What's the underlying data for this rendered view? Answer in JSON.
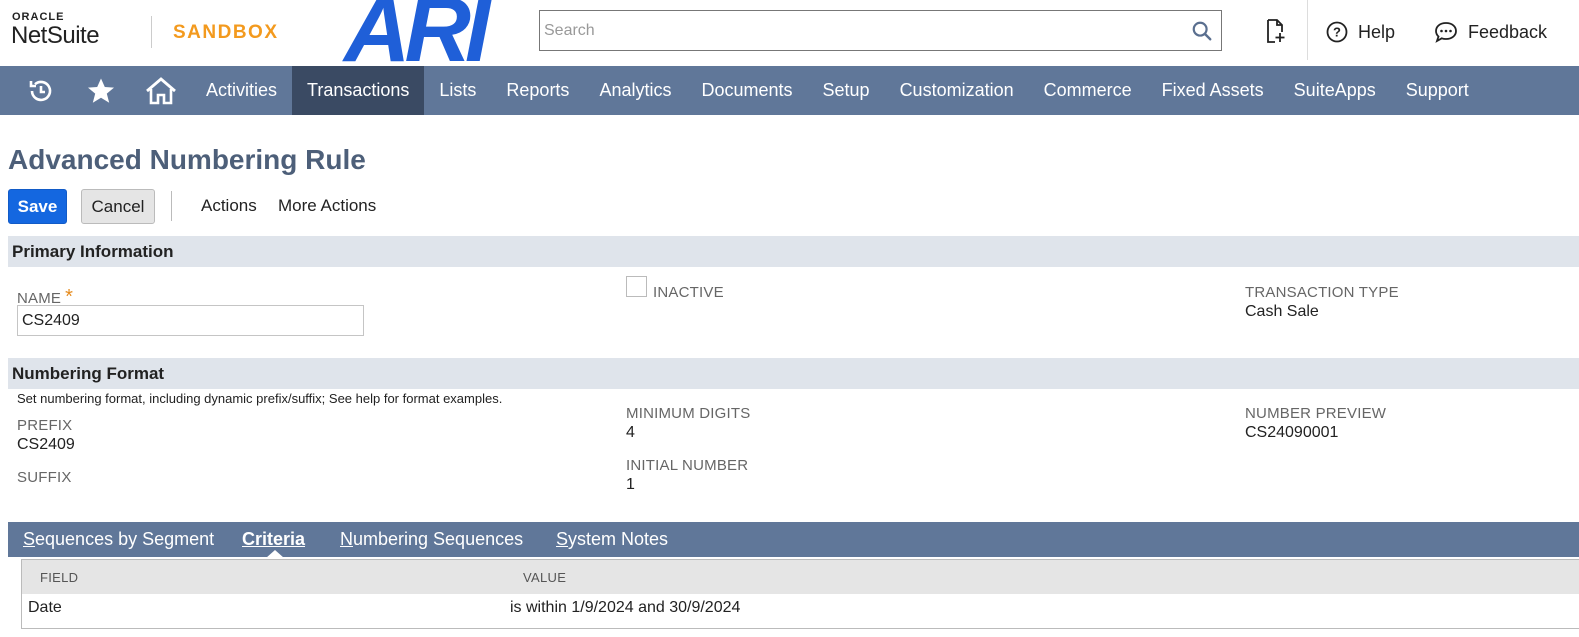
{
  "header": {
    "oracle_label": "ORACLE",
    "netsuite_label": "NetSuite",
    "sandbox_label": "SANDBOX",
    "brand_logo": "ARI",
    "search_placeholder": "Search",
    "help_label": "Help",
    "feedback_label": "Feedback",
    "icons": [
      "search-icon",
      "new-record-icon",
      "help-icon",
      "feedback-icon"
    ]
  },
  "nav": {
    "icons": [
      "recent-icon",
      "star-icon",
      "home-icon"
    ],
    "items": [
      {
        "label": "Activities",
        "active": false
      },
      {
        "label": "Transactions",
        "active": true
      },
      {
        "label": "Lists",
        "active": false
      },
      {
        "label": "Reports",
        "active": false
      },
      {
        "label": "Analytics",
        "active": false
      },
      {
        "label": "Documents",
        "active": false
      },
      {
        "label": "Setup",
        "active": false
      },
      {
        "label": "Customization",
        "active": false
      },
      {
        "label": "Commerce",
        "active": false
      },
      {
        "label": "Fixed Assets",
        "active": false
      },
      {
        "label": "SuiteApps",
        "active": false
      },
      {
        "label": "Support",
        "active": false
      }
    ]
  },
  "page": {
    "title": "Advanced Numbering Rule",
    "save_label": "Save",
    "cancel_label": "Cancel",
    "actions_label": "Actions",
    "more_actions_label": "More Actions"
  },
  "primary": {
    "section_title": "Primary Information",
    "name_label": "NAME",
    "name_value": "CS2409",
    "inactive_label": "INACTIVE",
    "inactive_checked": false,
    "transaction_type_label": "TRANSACTION TYPE",
    "transaction_type_value": "Cash Sale"
  },
  "numbering": {
    "section_title": "Numbering Format",
    "help_text": "Set numbering format, including dynamic prefix/suffix; See help for format examples.",
    "prefix_label": "PREFIX",
    "prefix_value": "CS2409",
    "suffix_label": "SUFFIX",
    "suffix_value": "",
    "min_digits_label": "MINIMUM DIGITS",
    "min_digits_value": "4",
    "initial_number_label": "INITIAL NUMBER",
    "initial_number_value": "1",
    "preview_label": "NUMBER PREVIEW",
    "preview_value": "CS24090001"
  },
  "subtabs": {
    "tabs": [
      {
        "first": "S",
        "rest": "equences by Segment",
        "active": false
      },
      {
        "first": "C",
        "rest": "riteria",
        "active": true
      },
      {
        "first": "N",
        "rest": "umbering Sequences",
        "active": false
      },
      {
        "first": "S",
        "rest": "ystem Notes",
        "active": false
      }
    ]
  },
  "criteria": {
    "columns": [
      "FIELD",
      "VALUE"
    ],
    "rows": [
      {
        "field": "Date",
        "value": "is within 1/9/2024 and 30/9/2024"
      }
    ]
  },
  "colors": {
    "nav_bg": "#607799",
    "nav_active_bg": "#3a4a63",
    "save_bg": "#1467e0",
    "sandbox": "#f39a1e",
    "brand": "#1f5fd8",
    "title": "#4d5f79"
  }
}
